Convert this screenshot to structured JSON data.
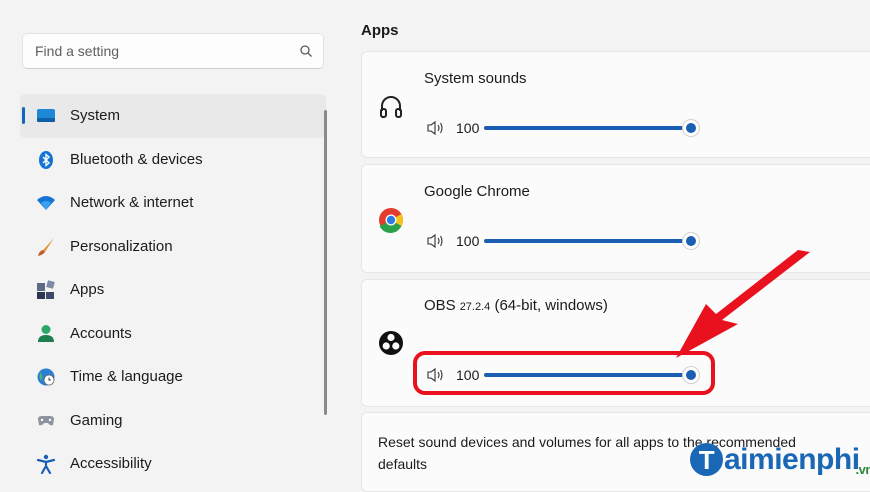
{
  "search": {
    "placeholder": "Find a setting",
    "icon": "search-icon"
  },
  "sidebar": {
    "items": [
      {
        "label": "System",
        "icon": "system-icon",
        "active": true
      },
      {
        "label": "Bluetooth & devices",
        "icon": "bluetooth-icon"
      },
      {
        "label": "Network & internet",
        "icon": "wifi-icon"
      },
      {
        "label": "Personalization",
        "icon": "brush-icon"
      },
      {
        "label": "Apps",
        "icon": "apps-icon"
      },
      {
        "label": "Accounts",
        "icon": "accounts-icon"
      },
      {
        "label": "Time & language",
        "icon": "globe-clock-icon"
      },
      {
        "label": "Gaming",
        "icon": "gamepad-icon"
      },
      {
        "label": "Accessibility",
        "icon": "accessibility-icon"
      }
    ]
  },
  "apps_section": {
    "title": "Apps",
    "apps": [
      {
        "name": "System sounds",
        "version": "",
        "suffix": "",
        "volume": "100",
        "volume_fraction": 1.0,
        "icon": "headphones-icon"
      },
      {
        "name": "Google Chrome",
        "version": "",
        "suffix": "",
        "volume": "100",
        "volume_fraction": 1.0,
        "icon": "chrome-icon"
      },
      {
        "name": "OBS",
        "version": "27.2.4",
        "suffix": "(64-bit, windows)",
        "volume": "100",
        "volume_fraction": 1.0,
        "icon": "obs-icon"
      }
    ],
    "reset_text": "Reset sound devices and volumes for all apps to the recommended defaults"
  },
  "watermark": {
    "letter": "T",
    "text": "aimienphi",
    "suffix": ".vn"
  },
  "colors": {
    "accent": "#1a5fb4",
    "highlight": "#e8111d",
    "watermark": "#1a67b6"
  }
}
